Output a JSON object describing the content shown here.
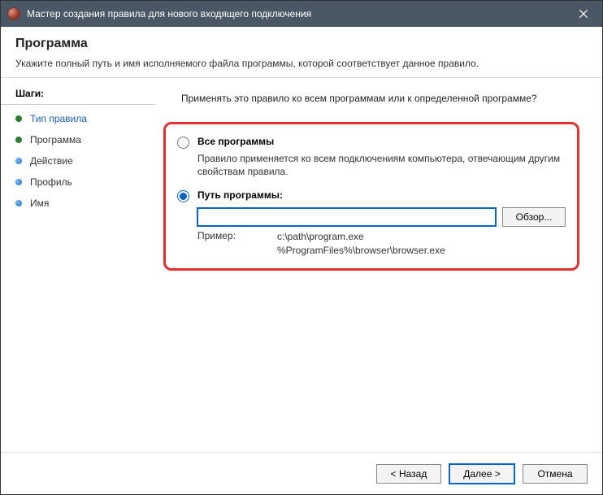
{
  "titlebar": {
    "title": "Мастер создания правила для нового входящего подключения"
  },
  "header": {
    "title": "Программа",
    "subtitle": "Укажите полный путь и имя исполняемого файла программы, которой соответствует данное правило."
  },
  "sidebar": {
    "header": "Шаги:",
    "steps": [
      {
        "label": "Тип правила"
      },
      {
        "label": "Программа"
      },
      {
        "label": "Действие"
      },
      {
        "label": "Профиль"
      },
      {
        "label": "Имя"
      }
    ]
  },
  "content": {
    "question": "Применять это правило ко всем программам или к определенной программе?",
    "option_all": {
      "label": "Все программы",
      "desc": "Правило применяется ко всем подключениям компьютера, отвечающим другим свойствам правила."
    },
    "option_path": {
      "label": "Путь программы:",
      "value": "",
      "browse": "Обзор...",
      "example_label": "Пример:",
      "example_values": "c:\\path\\program.exe\n%ProgramFiles%\\browser\\browser.exe"
    }
  },
  "footer": {
    "back": "< Назад",
    "next": "Далее >",
    "cancel": "Отмена"
  }
}
